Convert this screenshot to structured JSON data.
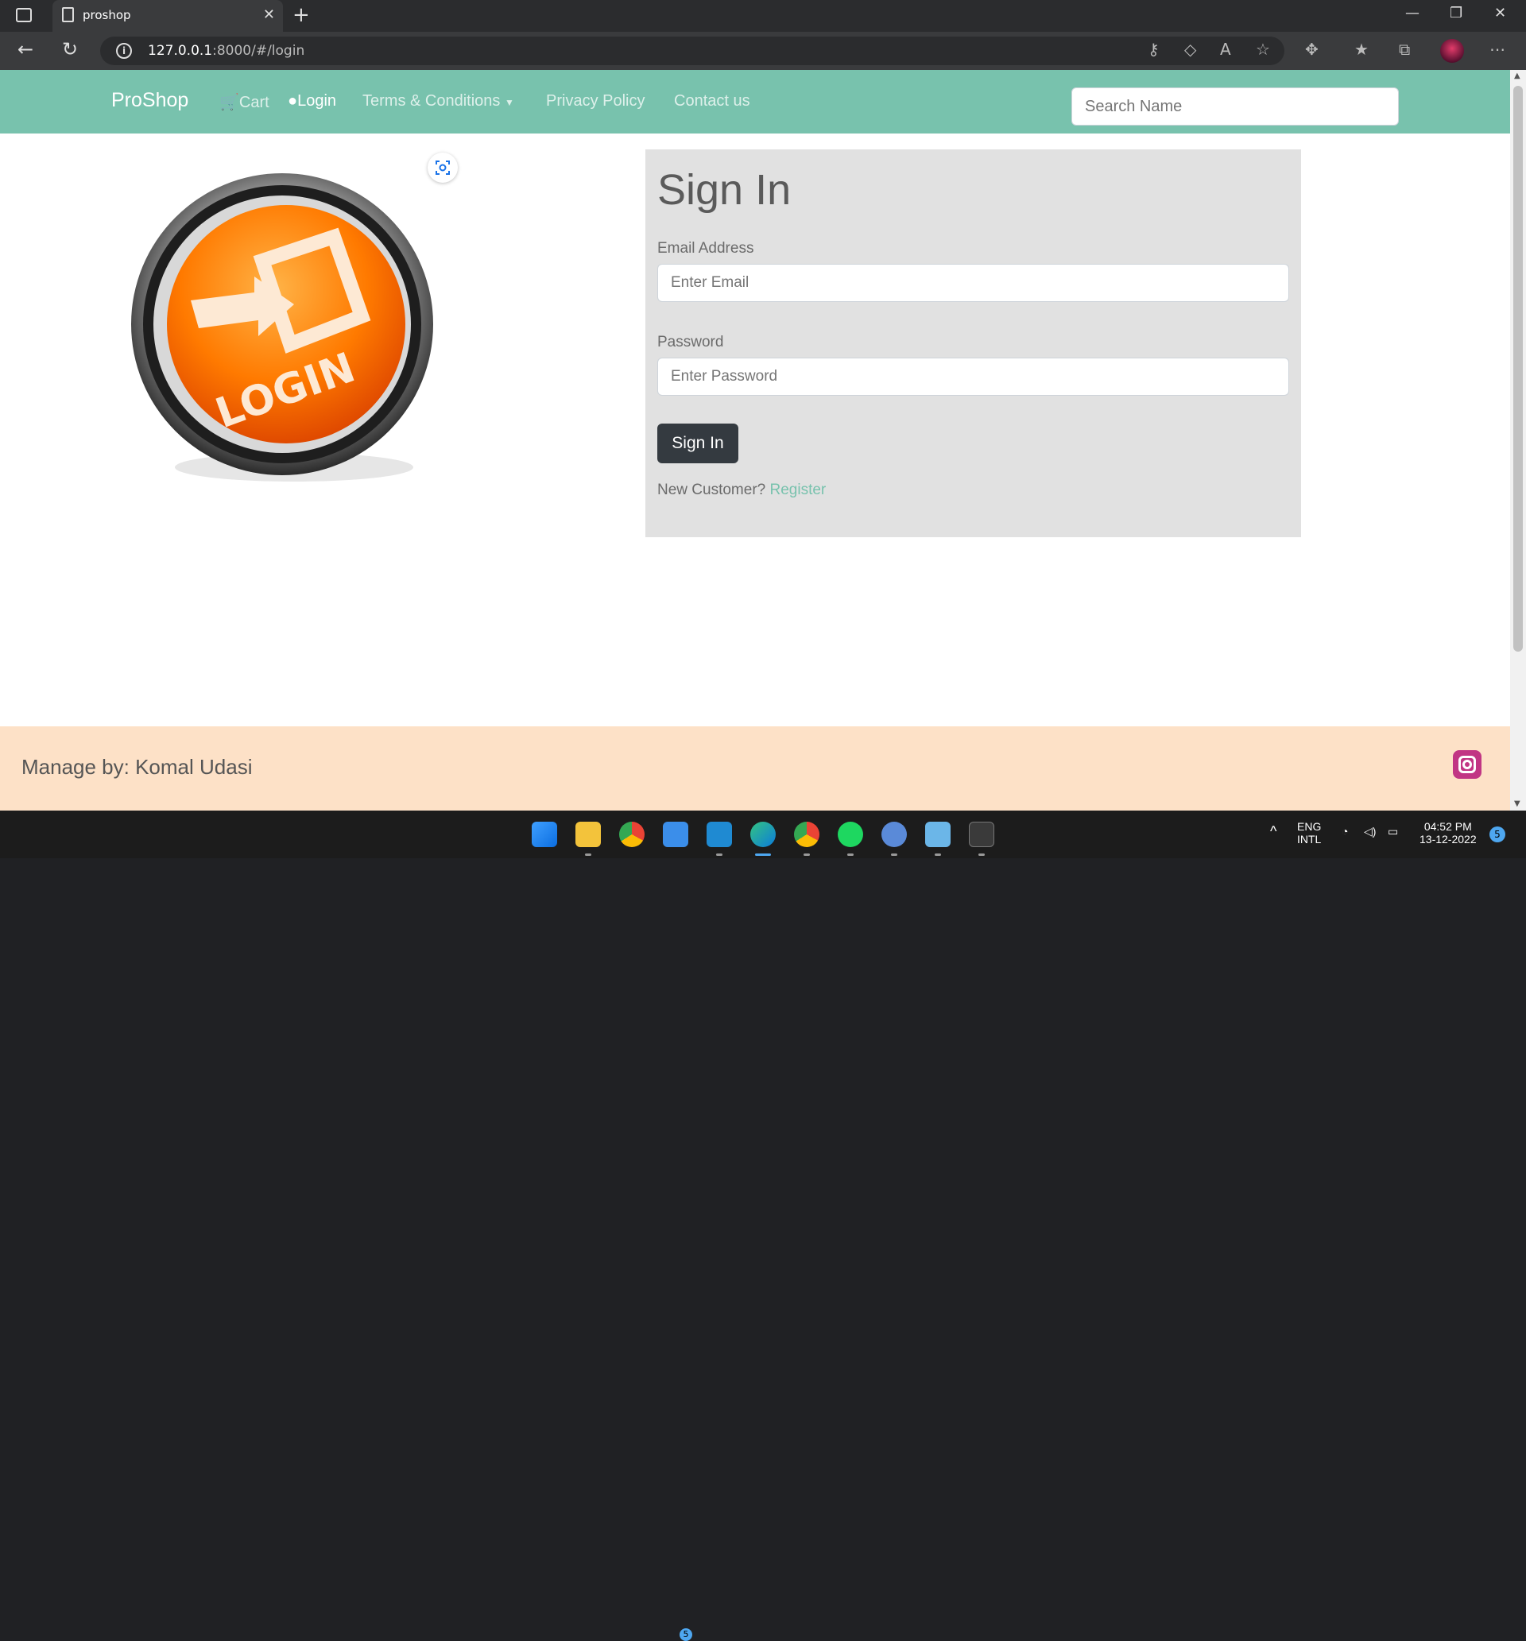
{
  "browser": {
    "tab_title": "proshop",
    "url_host": "127.0.0.1",
    "url_rest": ":8000/#/login"
  },
  "navbar": {
    "brand": "ProShop",
    "cart": "Cart",
    "login": "Login",
    "terms": "Terms & Conditions",
    "privacy": "Privacy Policy",
    "contact": "Contact us",
    "search_placeholder": "Search Name"
  },
  "hero_image": {
    "icon": "login-button-graphic",
    "text": "LOGIN"
  },
  "signin": {
    "title": "Sign In",
    "email_label": "Email Address",
    "email_placeholder": "Enter Email",
    "password_label": "Password",
    "password_placeholder": "Enter Password",
    "button": "Sign In",
    "new_customer": "New Customer?",
    "register": "Register"
  },
  "footer": {
    "text": "Manage by: Komal Udasi",
    "icon": "instagram-icon"
  },
  "taskbar": {
    "lang": "ENG",
    "layout": "INTL",
    "time": "04:52 PM",
    "date": "13-12-2022",
    "notifications": "5",
    "mail_badge": "5"
  },
  "colors": {
    "navbar": "#78c2ad",
    "footer": "#fde1c7",
    "card": "#e1e1e1",
    "button": "#343a40"
  }
}
